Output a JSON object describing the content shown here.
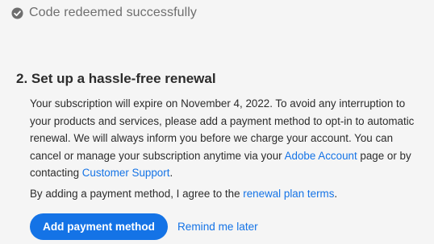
{
  "status": {
    "icon": "check-circle-icon",
    "text": "Code redeemed successfully"
  },
  "renewal": {
    "heading": "2. Set up a hassle-free renewal",
    "body_before_account_link": "Your subscription will expire on November 4, 2022. To avoid any interruption to your products and services, please add a payment method to opt-in to automatic renewal. We will always inform you before we charge your account. You can cancel or manage your subscription anytime via your ",
    "account_link": "Adobe Account",
    "body_between_links": " page or by contacting ",
    "support_link": "Customer Support",
    "body_end": ".",
    "agree_text": "By adding a payment method, I agree to the ",
    "terms_link": "renewal plan terms",
    "agree_end": "."
  },
  "actions": {
    "add_payment_label": "Add payment method",
    "remind_later_label": "Remind me later"
  },
  "colors": {
    "accent": "#1473e6",
    "background": "#f5f5f5",
    "muted_text": "#6e6e6e"
  }
}
